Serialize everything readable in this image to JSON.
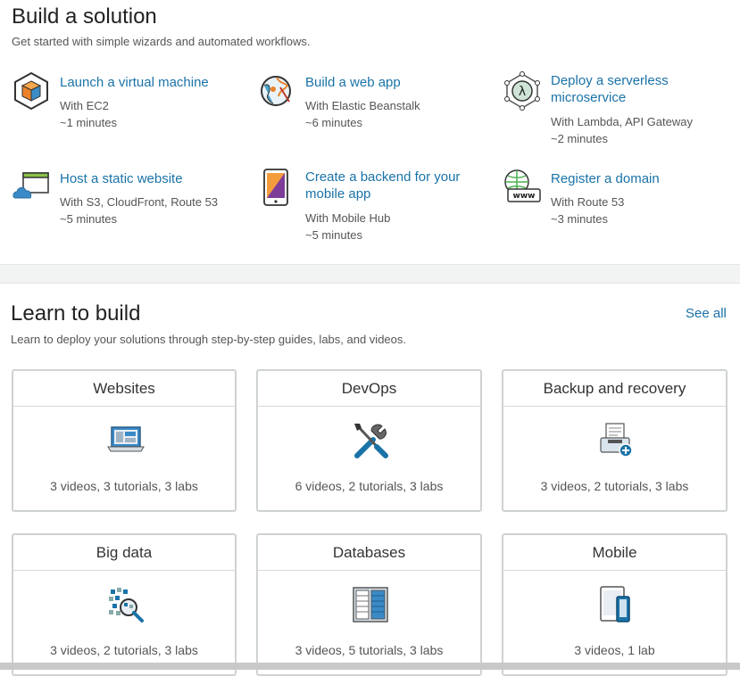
{
  "build": {
    "title": "Build a solution",
    "subtitle": "Get started with simple wizards and automated workflows.",
    "items": [
      {
        "title": "Launch a virtual machine",
        "with": "With EC2",
        "time": "~1 minutes",
        "icon": "virtual-machine-cube-icon"
      },
      {
        "title": "Build a web app",
        "with": "With Elastic Beanstalk",
        "time": "~6 minutes",
        "icon": "web-app-globe-icon"
      },
      {
        "title": "Deploy a serverless microservice",
        "with": "With Lambda, API Gateway",
        "time": "~2 minutes",
        "icon": "lambda-icon"
      },
      {
        "title": "Host a static website",
        "with": "With S3, CloudFront, Route 53",
        "time": "~5 minutes",
        "icon": "static-website-cloud-icon"
      },
      {
        "title": "Create a backend for your mobile app",
        "with": "With Mobile Hub",
        "time": "~5 minutes",
        "icon": "mobile-phone-icon"
      },
      {
        "title": "Register a domain",
        "with": "With Route 53",
        "time": "~3 minutes",
        "icon": "domain-www-icon"
      }
    ]
  },
  "learn": {
    "title": "Learn to build",
    "subtitle": "Learn to deploy your solutions through step-by-step guides, labs, and videos.",
    "see_all": "See all",
    "cards": [
      {
        "title": "Websites",
        "stats": "3 videos, 3 tutorials, 3 labs",
        "icon": "laptop-icon"
      },
      {
        "title": "DevOps",
        "stats": "6 videos, 2 tutorials, 3 labs",
        "icon": "tools-icon"
      },
      {
        "title": "Backup and recovery",
        "stats": "3 videos, 2 tutorials, 3 labs",
        "icon": "backup-drive-icon"
      },
      {
        "title": "Big data",
        "stats": "3 videos, 2 tutorials, 3 labs",
        "icon": "big-data-magnifier-icon"
      },
      {
        "title": "Databases",
        "stats": "3 videos, 5 tutorials, 3 labs",
        "icon": "database-table-icon"
      },
      {
        "title": "Mobile",
        "stats": "3 videos, 1 lab",
        "icon": "mobile-devices-icon"
      }
    ]
  }
}
